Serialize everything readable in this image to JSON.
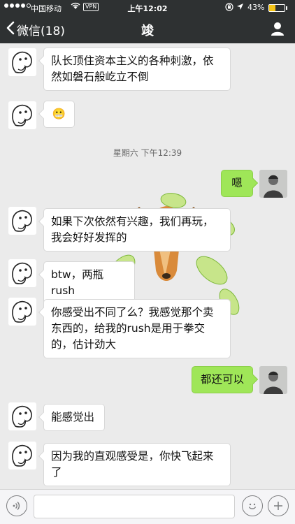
{
  "status_bar": {
    "carrier": "中国移动",
    "vpn": "VPN",
    "time": "上午12:02",
    "battery_percent": "43%",
    "battery_level": 0.43
  },
  "nav": {
    "back_label": "微信(18)",
    "title": "竣"
  },
  "timestamp": "星期六 下午12:39",
  "messages": [
    {
      "from": "them",
      "text": "队长顶住资本主义的各种刺激，依然如磐石般屹立不倒"
    },
    {
      "from": "them",
      "text": "😬"
    },
    {
      "from": "me",
      "text": "嗯"
    },
    {
      "from": "them",
      "text": "如果下次依然有兴趣，我们再玩，我会好好发挥的"
    },
    {
      "from": "them",
      "text": "btw，两瓶rush"
    },
    {
      "from": "them",
      "text": "你感受出不同了么？我感觉那个卖东西的，给我的rush是用于拳交的，估计劲大"
    },
    {
      "from": "me",
      "text": "都还可以"
    },
    {
      "from": "them",
      "text": "能感觉出"
    },
    {
      "from": "them",
      "text": "因为我的直观感受是，你快飞起来了"
    }
  ],
  "input": {
    "value": "",
    "placeholder": ""
  },
  "icons": {
    "back": "chevron-left-icon",
    "profile": "person-icon",
    "voice": "voice-icon",
    "emoji": "emoji-icon",
    "more": "plus-icon"
  },
  "colors": {
    "nav_bg": "#2e3132",
    "chat_bg": "#ebebeb",
    "my_bubble": "#9fe658",
    "their_bubble": "#ffffff"
  }
}
